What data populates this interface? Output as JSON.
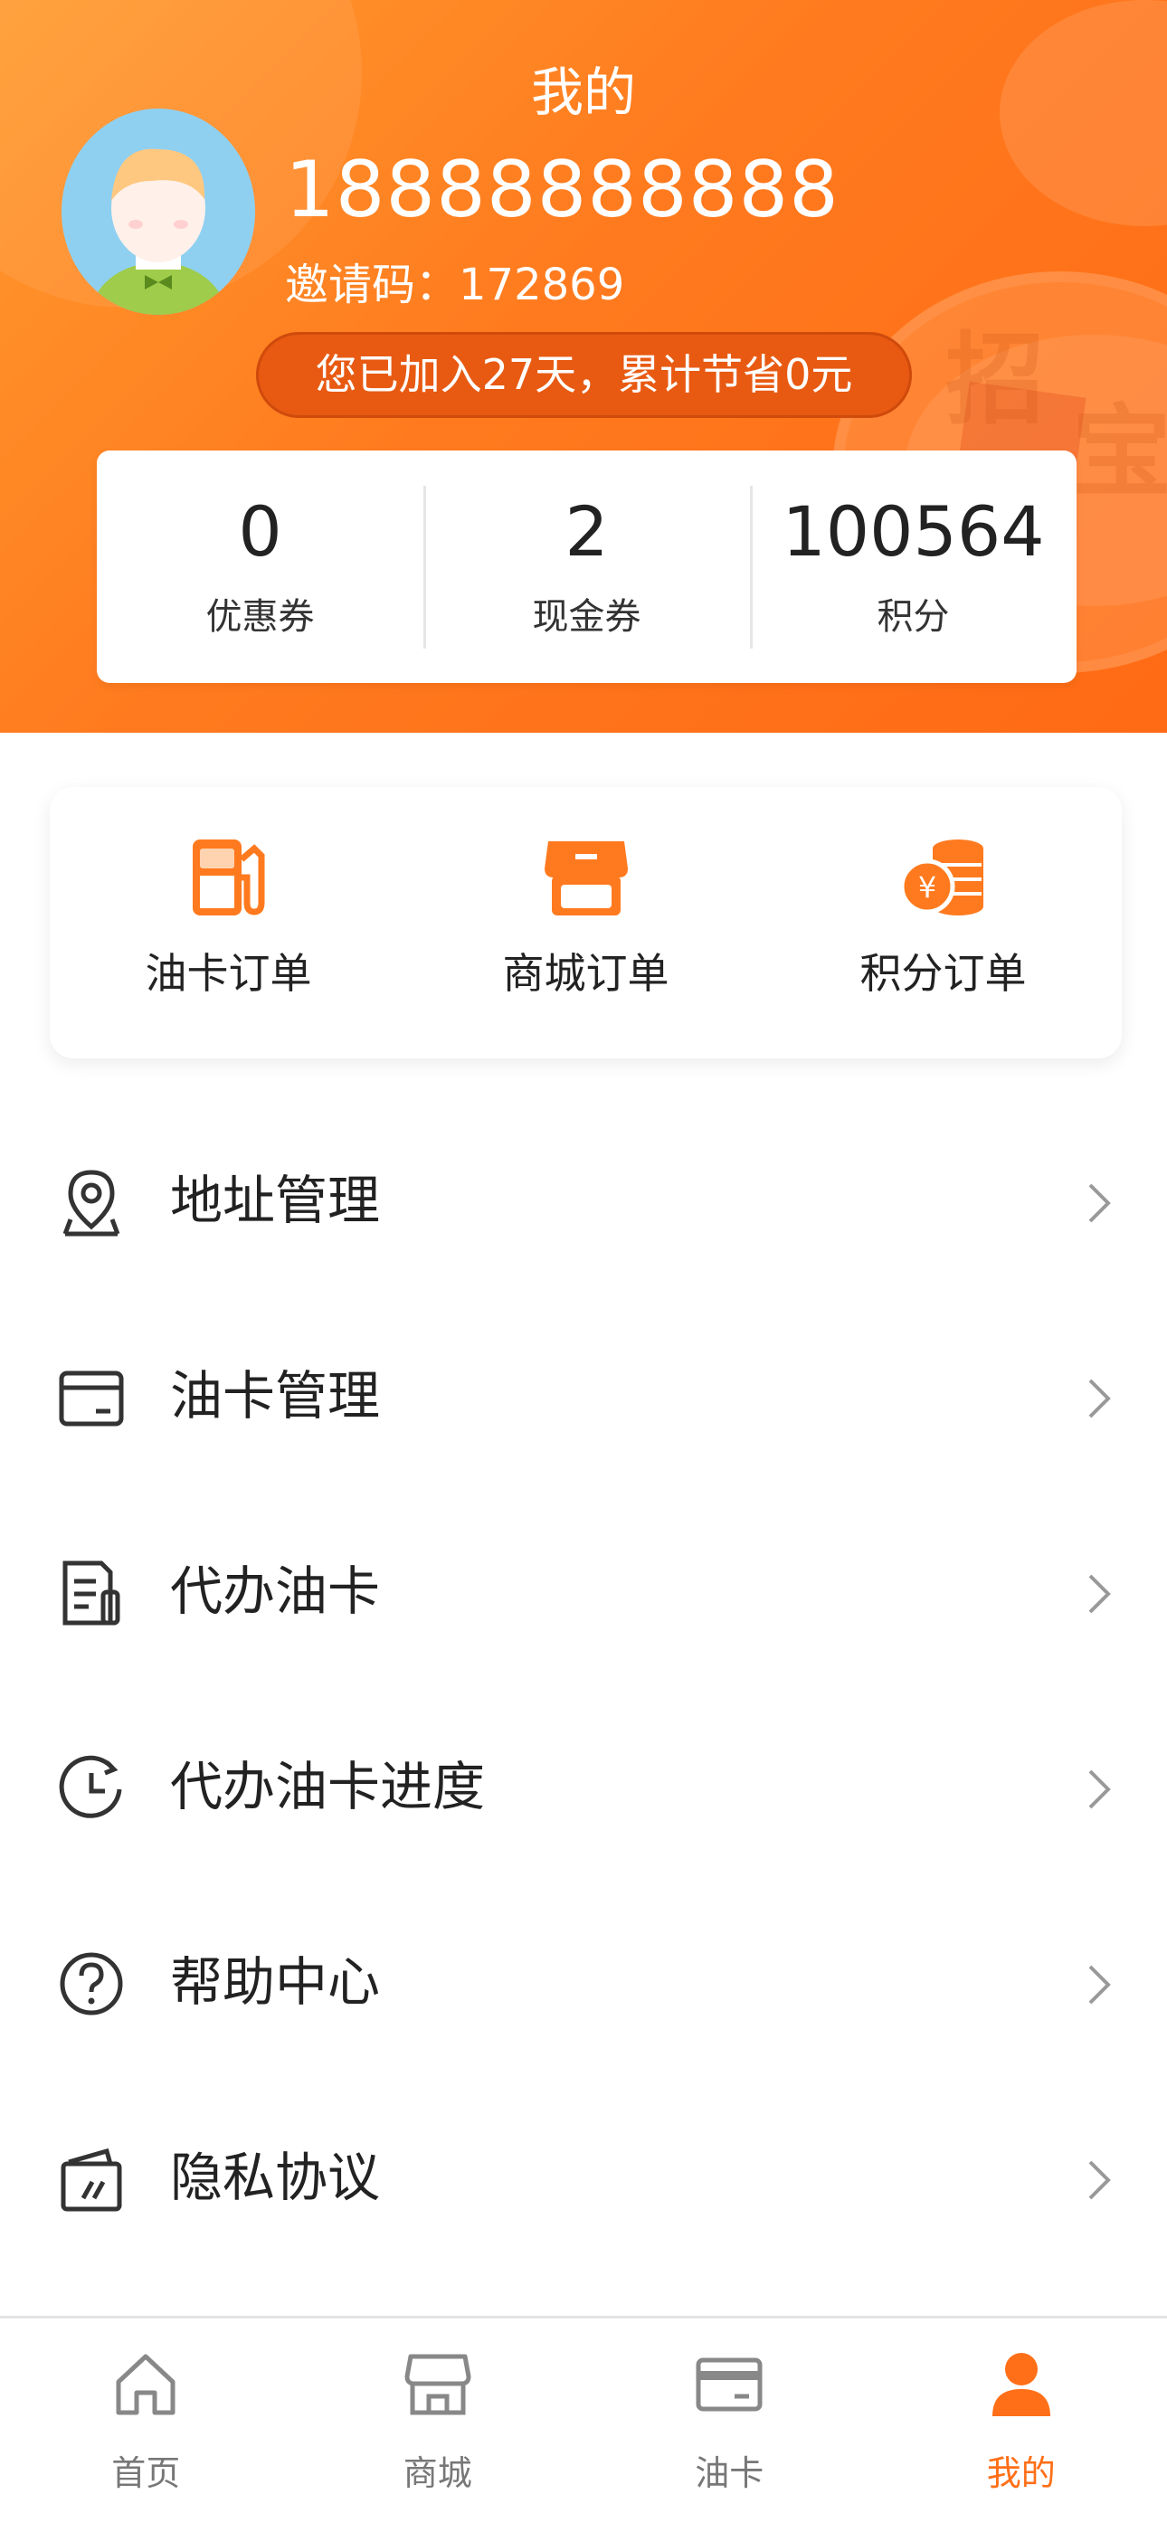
{
  "header": {
    "title": "我的",
    "phone": "18888888888",
    "invite_text": "邀请码：172869",
    "join_text": "您已加入27天，累计节省0元",
    "decor_chars": [
      "招",
      "宝"
    ]
  },
  "stats": [
    {
      "value": "0",
      "label": "优惠券"
    },
    {
      "value": "2",
      "label": "现金券"
    },
    {
      "value": "100564",
      "label": "积分"
    }
  ],
  "orders": [
    {
      "label": "油卡订单",
      "icon": "fuel-pump-icon"
    },
    {
      "label": "商城订单",
      "icon": "store-icon"
    },
    {
      "label": "积分订单",
      "icon": "coins-icon"
    }
  ],
  "menu": [
    {
      "label": "地址管理",
      "icon": "location-pin-icon"
    },
    {
      "label": "油卡管理",
      "icon": "card-icon"
    },
    {
      "label": "代办油卡",
      "icon": "document-icon"
    },
    {
      "label": "代办油卡进度",
      "icon": "clock-icon"
    },
    {
      "label": "帮助中心",
      "icon": "help-icon"
    },
    {
      "label": "隐私协议",
      "icon": "privacy-icon"
    }
  ],
  "tabs": [
    {
      "label": "首页",
      "icon": "home-icon",
      "active": false
    },
    {
      "label": "商城",
      "icon": "store-icon",
      "active": false
    },
    {
      "label": "油卡",
      "icon": "card-icon",
      "active": false
    },
    {
      "label": "我的",
      "icon": "user-icon",
      "active": true
    }
  ],
  "colors": {
    "accent": "#ff6f17",
    "header_start": "#ff9a2e",
    "header_end": "#ff6a14",
    "badge": "#e85a12"
  }
}
